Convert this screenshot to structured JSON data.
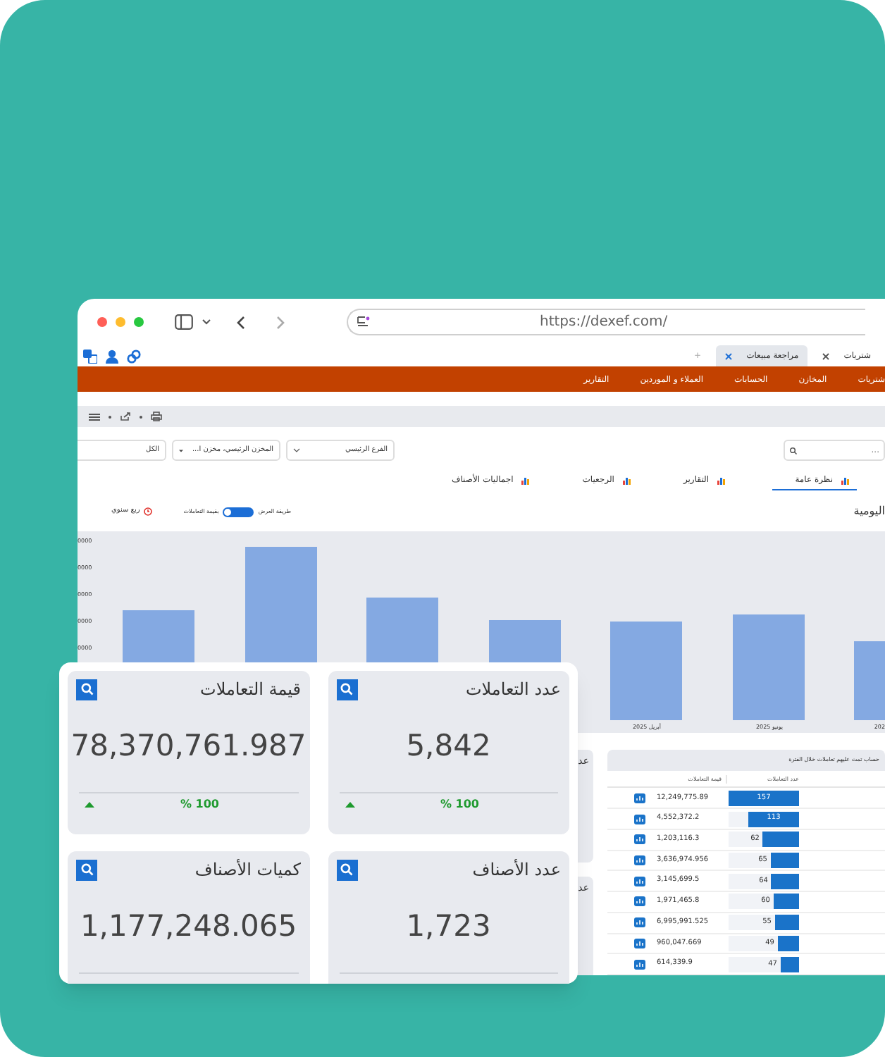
{
  "browser": {
    "url": "https://dexef.com/",
    "new_tab": "+",
    "tabs": [
      {
        "label": "شتريات",
        "selected": false
      },
      {
        "label": "مراجعة مبيعات",
        "selected": true
      }
    ]
  },
  "nav": [
    "شتريات",
    "المخازن",
    "الحسابات",
    "العملاء و الموردين",
    "التقارير"
  ],
  "filters": {
    "search_placeholder": "...",
    "branch": "الفرع الرئيسي",
    "store": "المخزن الرئيسي، مخزن ا...",
    "category": "الكل"
  },
  "view_tabs": [
    {
      "label": "نظرة عامة",
      "selected": true
    },
    {
      "label": "التقارير",
      "selected": false
    },
    {
      "label": "الرجعيات",
      "selected": false
    },
    {
      "label": "اجماليات الأصناف",
      "selected": false
    }
  ],
  "section_title": "اليومية",
  "display_mode": {
    "label": "طريقة العرض",
    "value": "بقيمة التعاملات",
    "on": true
  },
  "period": "ربع سنوي",
  "chart": {
    "y_ticks": [
      "0000",
      "0000",
      "0000",
      "0000",
      "0000"
    ],
    "x_labels": [
      "202",
      "يونيو 2025",
      "أبريل 2025"
    ]
  },
  "side_titles": [
    "عد",
    "عد"
  ],
  "table": {
    "title": "حساب تمت عليهم تعاملات خلال الفترة",
    "columns": [
      "عدد التعاملات",
      "قيمة التعاملات"
    ],
    "rows": [
      {
        "count": "157",
        "value": "12,249,775.89",
        "level": 1
      },
      {
        "count": "113",
        "value": "4,552,372.2",
        "level": 0.72
      },
      {
        "count": "62",
        "value": "1,203,116.3",
        "level": 0.52
      },
      {
        "count": "65",
        "value": "3,636,974.956",
        "level": 0.41
      },
      {
        "count": "64",
        "value": "3,145,699.5",
        "level": 0.4
      },
      {
        "count": "60",
        "value": "1,971,465.8",
        "level": 0.37
      },
      {
        "count": "55",
        "value": "6,995,991.525",
        "level": 0.35
      },
      {
        "count": "49",
        "value": "960,047.669",
        "level": 0.31
      },
      {
        "count": "47",
        "value": "614,339.9",
        "level": 0.27
      }
    ]
  },
  "cards": [
    {
      "title": "عدد التعاملات",
      "value": "5,842",
      "change": "% 100",
      "trend_up": true
    },
    {
      "title": "قيمة التعاملات",
      "value": "78,370,761.987",
      "change": "% 100",
      "trend_up": true
    },
    {
      "title": "عدد الأصناف",
      "value": "1,723",
      "trend_up": false
    },
    {
      "title": "كميات الأصناف",
      "value": "1,177,248.065",
      "trend_up": false
    }
  ]
}
